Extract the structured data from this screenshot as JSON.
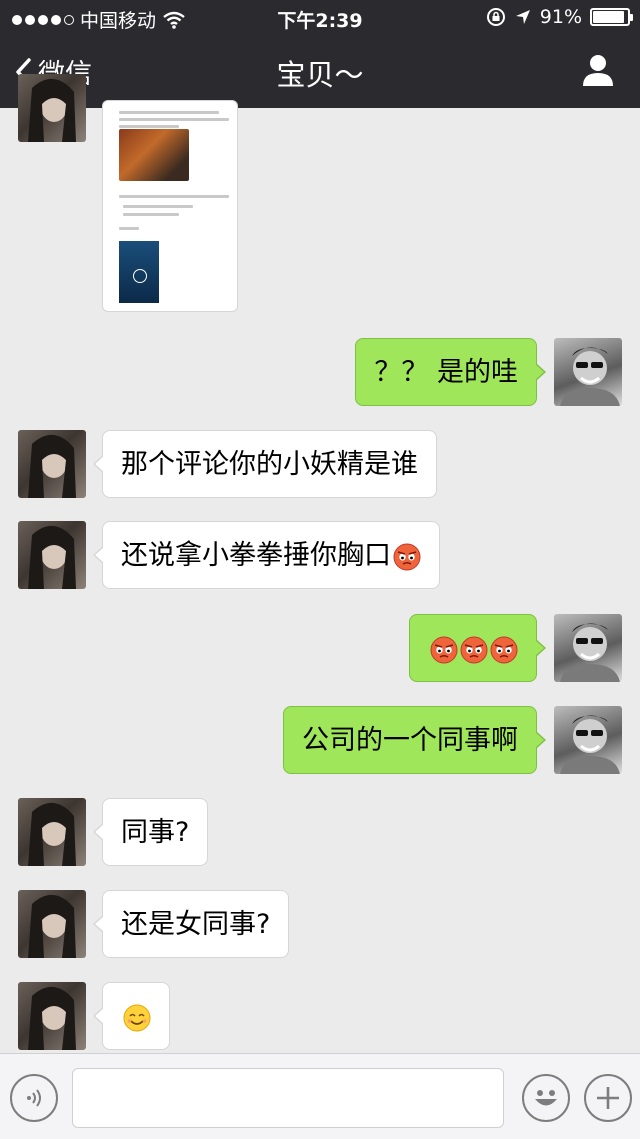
{
  "status_bar": {
    "carrier": "中国移动",
    "time": "下午2:39",
    "battery_text": "91%",
    "battery_level": 0.91,
    "signal_bars_filled": 4,
    "signal_bars_total": 5
  },
  "navbar": {
    "back_label": "微信",
    "title": "宝贝～"
  },
  "messages": [
    {
      "sender": "her",
      "type": "image"
    },
    {
      "sender": "me",
      "text": "？？ 是的哇"
    },
    {
      "sender": "her",
      "text": "那个评论你的小妖精是谁"
    },
    {
      "sender": "her",
      "text": "还说拿小拳拳捶你胸口",
      "emoji": [
        "angry-face-icon"
      ]
    },
    {
      "sender": "me",
      "text": "",
      "emoji": [
        "angry-face-icon",
        "angry-face-icon",
        "angry-face-icon"
      ]
    },
    {
      "sender": "me",
      "text": "公司的一个同事啊"
    },
    {
      "sender": "her",
      "text": "同事?"
    },
    {
      "sender": "her",
      "text": "还是女同事?"
    },
    {
      "sender": "her",
      "text": "",
      "emoji": [
        "smile-face-icon"
      ]
    }
  ],
  "input_bar": {
    "placeholder": "",
    "value": ""
  },
  "colors": {
    "topbar_bg": "#2b2a2f",
    "chat_bg": "#ebebeb",
    "outgoing_bubble": "#9fe65a",
    "incoming_bubble": "#ffffff"
  }
}
